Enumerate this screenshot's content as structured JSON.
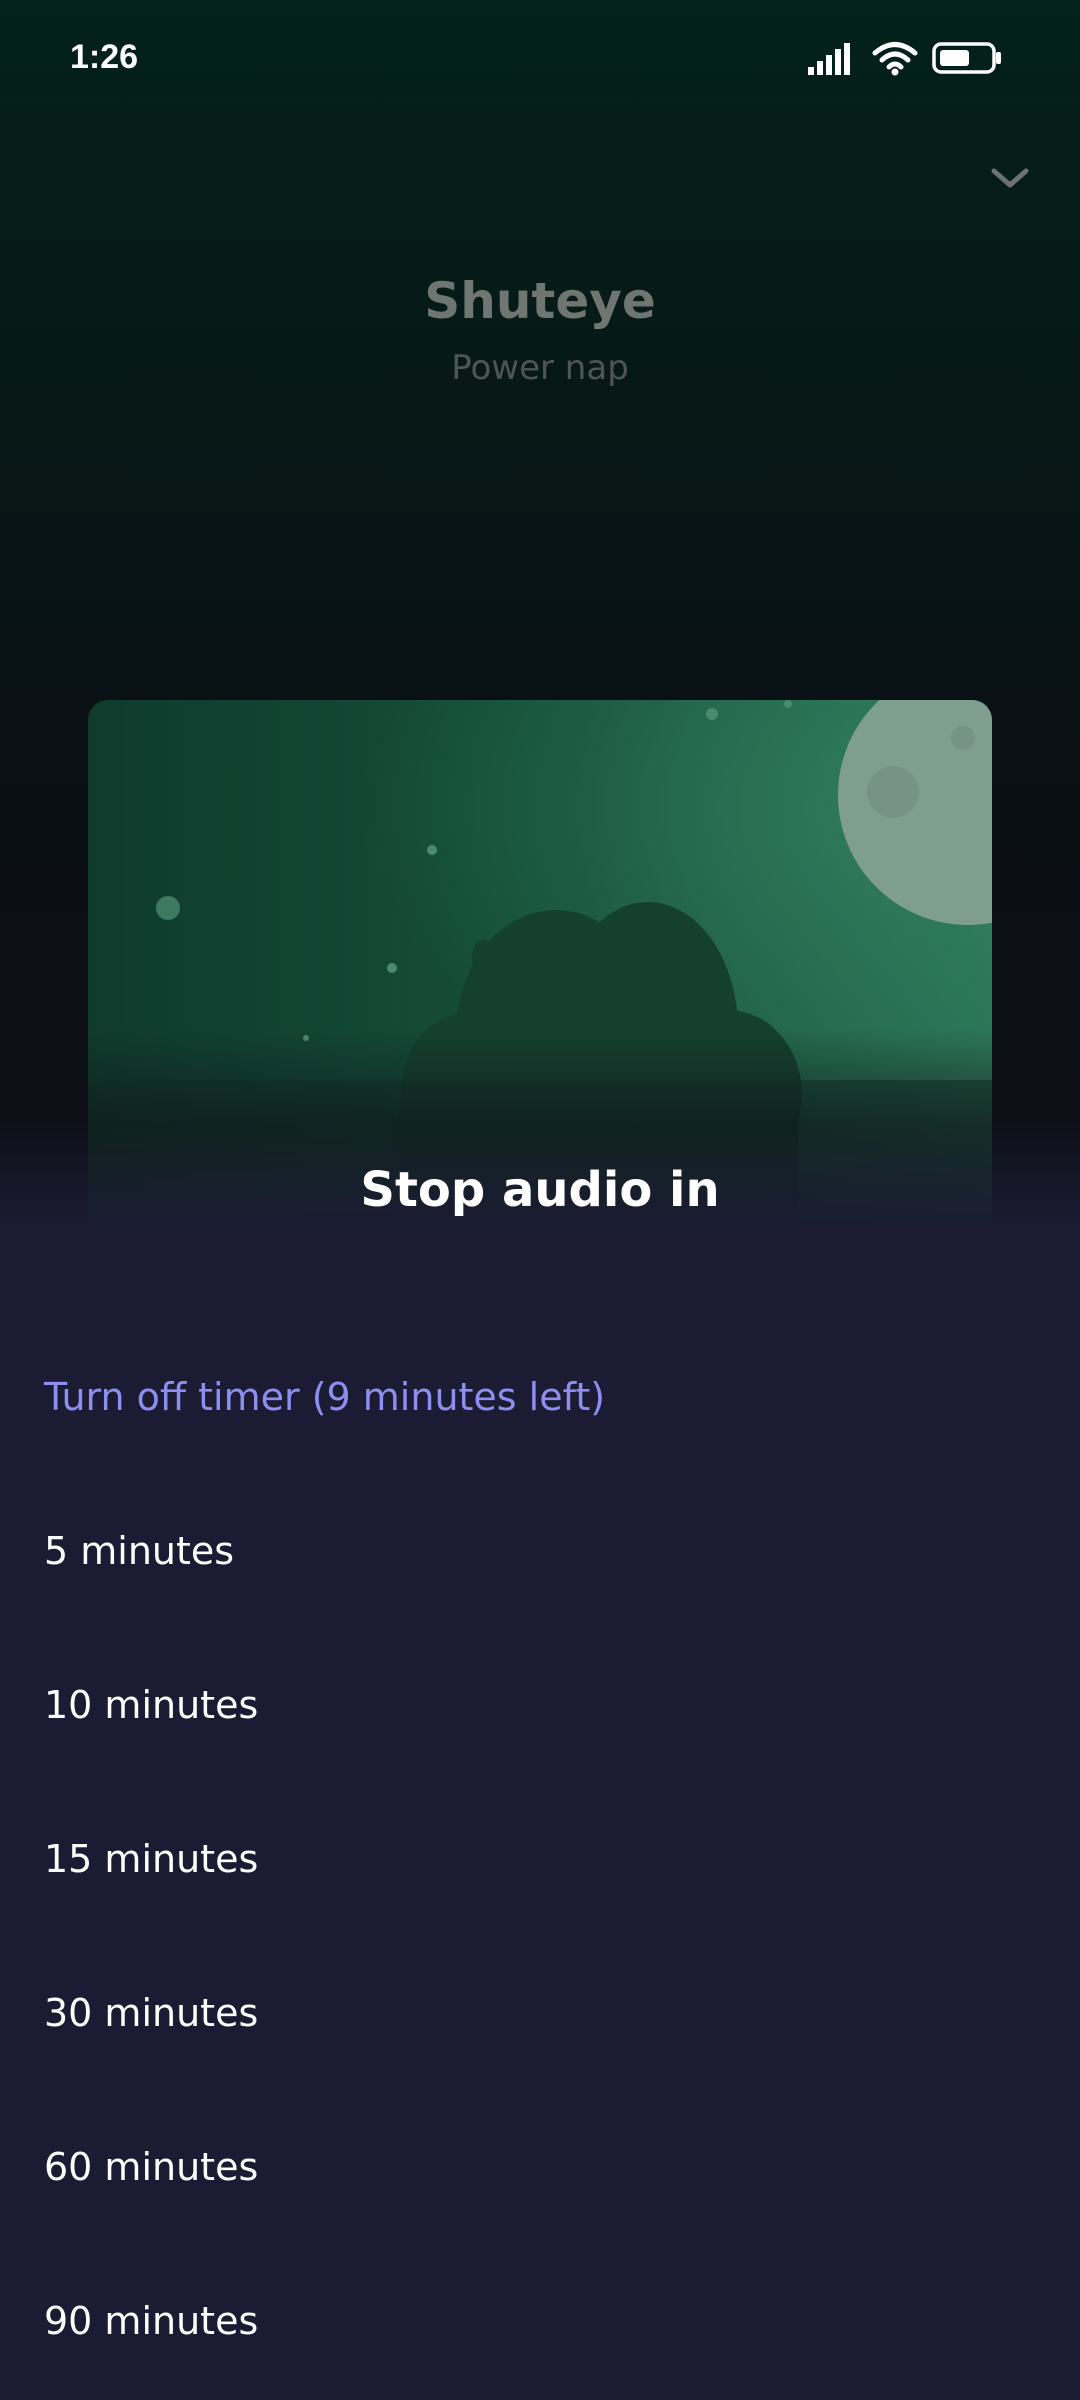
{
  "status_bar": {
    "time": "1:26",
    "icons": [
      "signal-icon",
      "wifi-icon",
      "battery-icon"
    ],
    "battery_level": 0.6
  },
  "player": {
    "title": "Shuteye",
    "subtitle": "Power nap",
    "collapse_icon": "chevron-down-icon"
  },
  "sheet": {
    "title": "Stop audio in",
    "options": [
      {
        "label": "Turn off timer (9 minutes left)",
        "active": true
      },
      {
        "label": "5 minutes",
        "active": false
      },
      {
        "label": "10 minutes",
        "active": false
      },
      {
        "label": "15 minutes",
        "active": false
      },
      {
        "label": "30 minutes",
        "active": false
      },
      {
        "label": "60 minutes",
        "active": false
      },
      {
        "label": "90 minutes",
        "active": false
      }
    ]
  },
  "colors": {
    "background_top": "#04211b",
    "sheet_background": "#1b1c33",
    "accent": "#8d8ef0",
    "artwork_green": "#1f6b4f"
  }
}
